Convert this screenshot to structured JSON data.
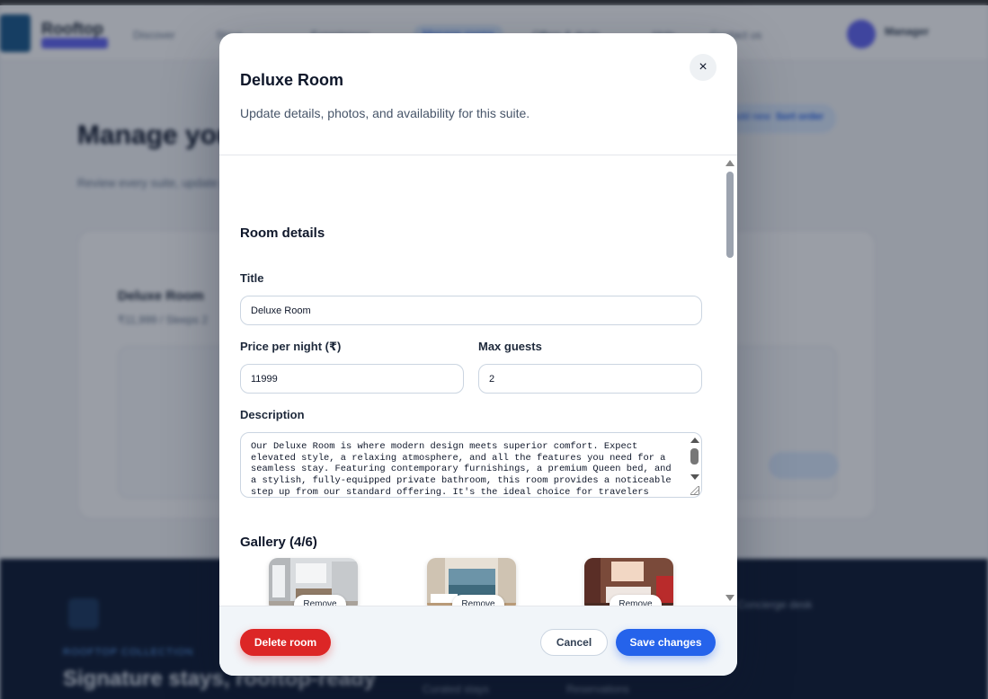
{
  "background": {
    "brand_name": "Rooftop",
    "nav_items": [
      "Discover",
      "Stays",
      "Experiences",
      "Manage rooms",
      "Offers & deals",
      "Help",
      "Contact us"
    ],
    "user_name": "Manager",
    "heading": "Manage your rooms",
    "subheading": "Review every suite, update pricing and availability.",
    "chip_left": "Add new",
    "chip_right": "Sort order",
    "card_title": "Deluxe Room",
    "card_subtitle": "₹11,999 / Sleeps 2",
    "footer_kicker": "ROOFTOP COLLECTION",
    "footer_title": "Signature stays, rooftop-ready",
    "footer_col_1": "Curated stays",
    "footer_col_2": "Reservations",
    "footer_col_3": "Concierge desk"
  },
  "modal": {
    "title": "Deluxe Room",
    "subtitle": "Update details, photos, and availability for this suite.",
    "close_label": "×",
    "section_room_details": "Room details",
    "title_label": "Title",
    "title_value": "Deluxe Room",
    "price_label": "Price per night (₹)",
    "price_value": "11999",
    "guests_label": "Max guests",
    "guests_value": "2",
    "description_label": "Description",
    "description_value": "Our Deluxe Room is where modern design meets superior comfort. Expect elevated style, a relaxing atmosphere, and all the features you need for a seamless stay. Featuring contemporary furnishings, a premium Queen bed, and a stylish, fully-equipped private bathroom, this room provides a noticeable step up from our standard offering. It's the ideal choice for travelers",
    "gallery_title": "Gallery (4/6)",
    "remove_label": "Remove",
    "delete_label": "Delete room",
    "cancel_label": "Cancel",
    "save_label": "Save changes"
  },
  "colors": {
    "primary": "#2563eb",
    "danger": "#dc2626"
  }
}
